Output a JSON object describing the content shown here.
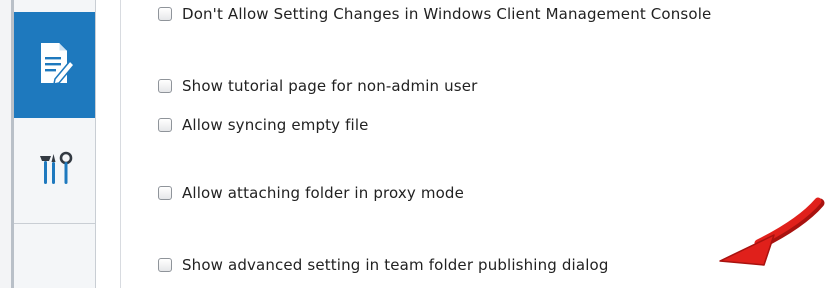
{
  "sidebar": {
    "items": [
      {
        "icon": "document-edit-icon",
        "active": true
      },
      {
        "icon": "tools-icon",
        "active": false
      }
    ]
  },
  "options": [
    {
      "label": "Don't Allow Setting Changes in Windows Client Management Console",
      "checked": false
    },
    {
      "label": "Show tutorial page for non-admin user",
      "checked": false
    },
    {
      "label": "Allow syncing empty file",
      "checked": false
    },
    {
      "label": "Allow attaching folder in proxy mode",
      "checked": false
    },
    {
      "label": "Show advanced setting in team folder publishing dialog",
      "checked": false
    }
  ],
  "annotation": {
    "icon": "red-arrow-icon",
    "color": "#e0201b"
  },
  "colors": {
    "accent": "#1e79be",
    "text": "#222222"
  }
}
